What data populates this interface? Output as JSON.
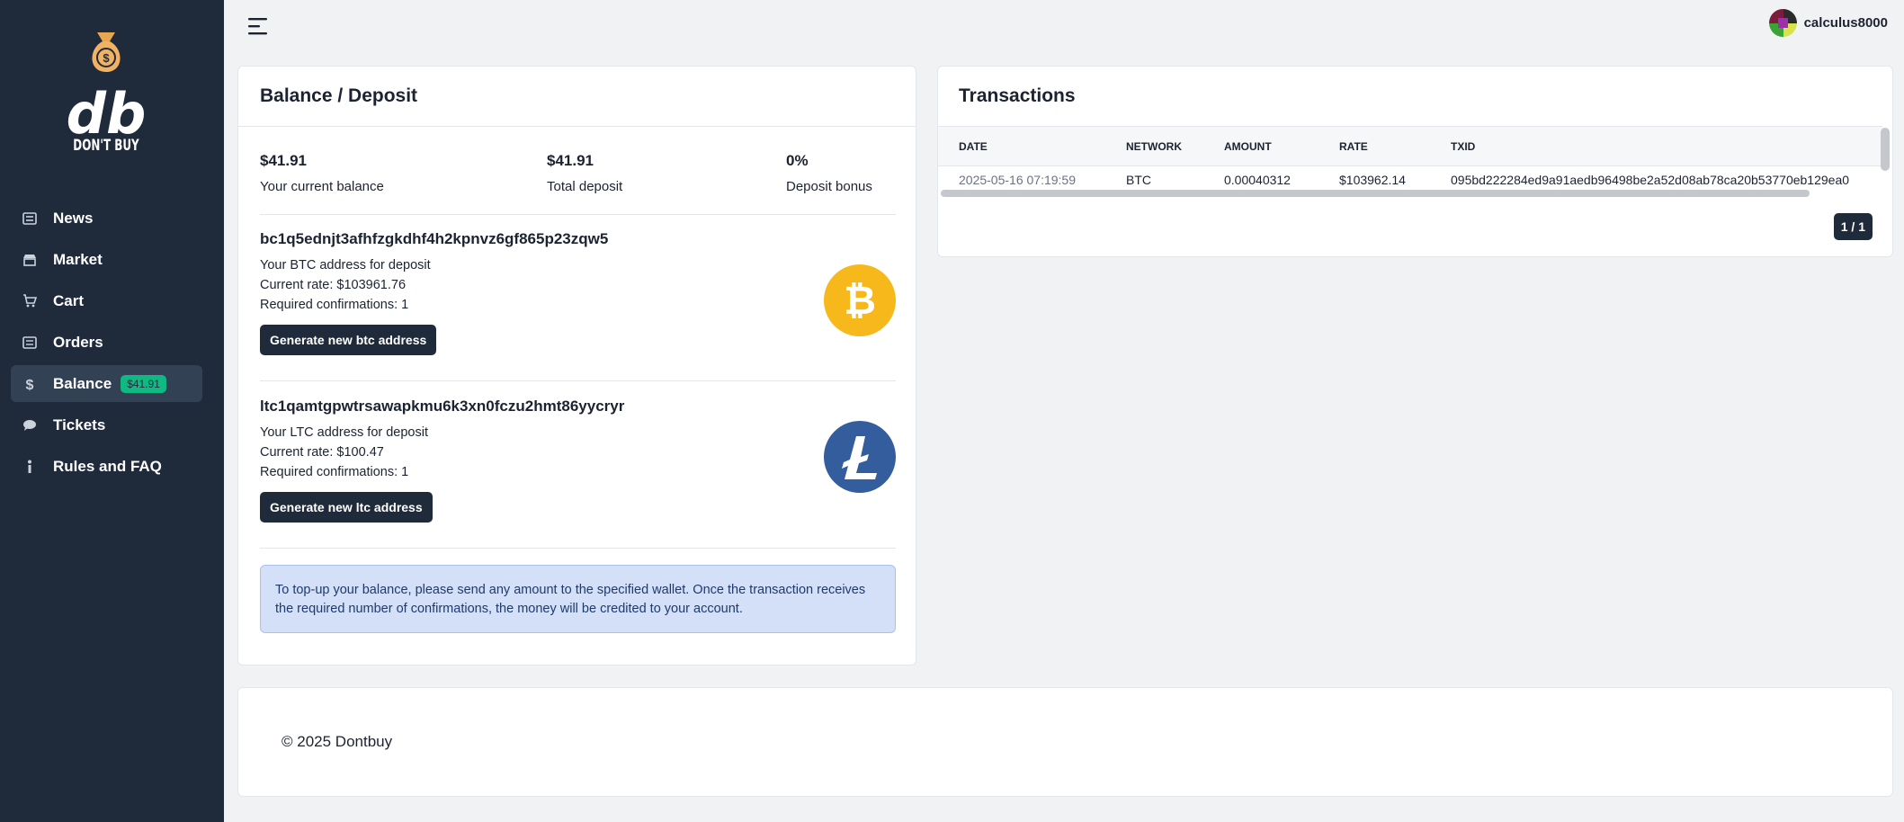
{
  "brand": {
    "logo_text": "DON'T BUY"
  },
  "nav": {
    "items": [
      {
        "label": "News",
        "icon": "newspaper-icon"
      },
      {
        "label": "Market",
        "icon": "store-icon"
      },
      {
        "label": "Cart",
        "icon": "cart-icon"
      },
      {
        "label": "Orders",
        "icon": "list-icon"
      },
      {
        "label": "Balance",
        "icon": "dollar-icon",
        "badge": "$41.91",
        "active": true
      },
      {
        "label": "Tickets",
        "icon": "chat-icon"
      },
      {
        "label": "Rules and FAQ",
        "icon": "info-icon"
      }
    ]
  },
  "header": {
    "username": "calculus8000"
  },
  "balance": {
    "title": "Balance / Deposit",
    "stats": [
      {
        "value": "$41.91",
        "label": "Your current balance"
      },
      {
        "value": "$41.91",
        "label": "Total deposit"
      },
      {
        "value": "0%",
        "label": "Deposit bonus"
      }
    ],
    "btc": {
      "address": "bc1q5ednjt3afhfzgkdhf4h2kpnvz6gf865p23zqw5",
      "desc": "Your BTC address for deposit",
      "rate": "Current rate: $103961.76",
      "confirmations": "Required confirmations: 1",
      "button": "Generate new btc address",
      "color": "#f7b81b"
    },
    "ltc": {
      "address": "ltc1qamtgpwtrsawapkmu6k3xn0fczu2hmt86yycryr",
      "desc": "Your LTC address for deposit",
      "rate": "Current rate: $100.47",
      "confirmations": "Required confirmations: 1",
      "button": "Generate new ltc address",
      "color": "#345d9d"
    },
    "info": "To top-up your balance, please send any amount to the specified wallet. Once the transaction receives the required number of confirmations, the money will be credited to your account."
  },
  "transactions": {
    "title": "Transactions",
    "columns": [
      "DATE",
      "NETWORK",
      "AMOUNT",
      "RATE",
      "TXID"
    ],
    "rows": [
      [
        "2025-05-16 07:19:59",
        "BTC",
        "0.00040312",
        "$103962.14",
        "095bd222284ed9a91aedb96498be2a52d08ab78ca20b53770eb129ea0"
      ]
    ],
    "pager": "1 / 1"
  },
  "footer": {
    "text": "© 2025 Dontbuy"
  }
}
